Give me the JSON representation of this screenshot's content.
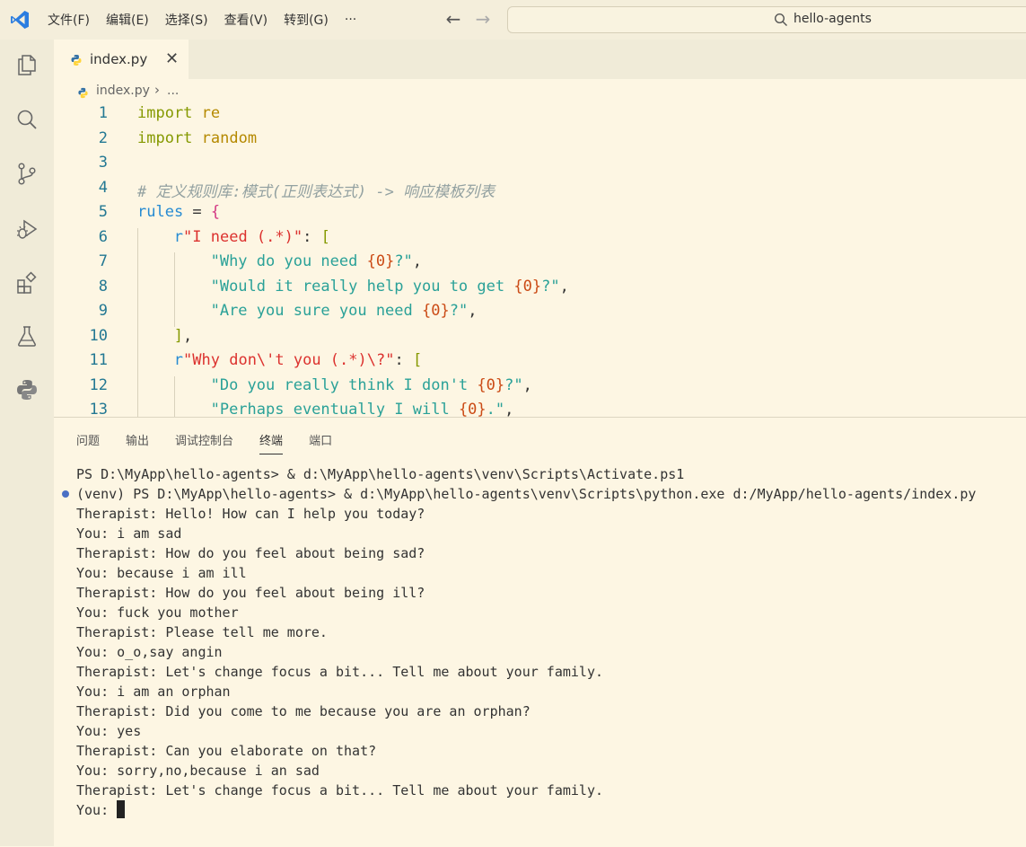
{
  "menubar": {
    "items": [
      "文件(F)",
      "编辑(E)",
      "选择(S)",
      "查看(V)",
      "转到(G)",
      "···"
    ]
  },
  "command_center": {
    "text": "hello-agents"
  },
  "tab": {
    "label": "index.py",
    "close": "✕"
  },
  "breadcrumb": {
    "file": "index.py",
    "sep": "›",
    "more": "..."
  },
  "code_lines": [
    {
      "n": "1",
      "indent": 0,
      "tokens": [
        {
          "c": "kw",
          "t": "import"
        },
        {
          "c": "op",
          "t": " "
        },
        {
          "c": "mod",
          "t": "re"
        }
      ]
    },
    {
      "n": "2",
      "indent": 0,
      "tokens": [
        {
          "c": "kw",
          "t": "import"
        },
        {
          "c": "op",
          "t": " "
        },
        {
          "c": "mod",
          "t": "random"
        }
      ]
    },
    {
      "n": "3",
      "indent": 0,
      "tokens": []
    },
    {
      "n": "4",
      "indent": 0,
      "tokens": [
        {
          "c": "cmt",
          "t": "# 定义规则库:模式(正则表达式) -> 响应模板列表"
        }
      ]
    },
    {
      "n": "5",
      "indent": 0,
      "tokens": [
        {
          "c": "id",
          "t": "rules"
        },
        {
          "c": "op",
          "t": " = "
        },
        {
          "c": "br",
          "t": "{"
        }
      ]
    },
    {
      "n": "6",
      "indent": 1,
      "tokens": [
        {
          "c": "id",
          "t": "r"
        },
        {
          "c": "rx",
          "t": "\"I need (.*)\""
        },
        {
          "c": "op",
          "t": ": "
        },
        {
          "c": "br2",
          "t": "["
        }
      ]
    },
    {
      "n": "7",
      "indent": 2,
      "tokens": [
        {
          "c": "str",
          "t": "\"Why do you need "
        },
        {
          "c": "fmt",
          "t": "{0}"
        },
        {
          "c": "str",
          "t": "?\""
        },
        {
          "c": "op",
          "t": ","
        }
      ]
    },
    {
      "n": "8",
      "indent": 2,
      "tokens": [
        {
          "c": "str",
          "t": "\"Would it really help you to get "
        },
        {
          "c": "fmt",
          "t": "{0}"
        },
        {
          "c": "str",
          "t": "?\""
        },
        {
          "c": "op",
          "t": ","
        }
      ]
    },
    {
      "n": "9",
      "indent": 2,
      "tokens": [
        {
          "c": "str",
          "t": "\"Are you sure you need "
        },
        {
          "c": "fmt",
          "t": "{0}"
        },
        {
          "c": "str",
          "t": "?\""
        },
        {
          "c": "op",
          "t": ","
        }
      ]
    },
    {
      "n": "10",
      "indent": 1,
      "tokens": [
        {
          "c": "br2",
          "t": "]"
        },
        {
          "c": "op",
          "t": ","
        }
      ]
    },
    {
      "n": "11",
      "indent": 1,
      "tokens": [
        {
          "c": "id",
          "t": "r"
        },
        {
          "c": "rx",
          "t": "\"Why don\\'t you (.*)\\?\""
        },
        {
          "c": "op",
          "t": ": "
        },
        {
          "c": "br2",
          "t": "["
        }
      ]
    },
    {
      "n": "12",
      "indent": 2,
      "tokens": [
        {
          "c": "str",
          "t": "\"Do you really think I don't "
        },
        {
          "c": "fmt",
          "t": "{0}"
        },
        {
          "c": "str",
          "t": "?\""
        },
        {
          "c": "op",
          "t": ","
        }
      ]
    },
    {
      "n": "13",
      "indent": 2,
      "tokens": [
        {
          "c": "str",
          "t": "\"Perhaps eventually I will "
        },
        {
          "c": "fmt",
          "t": "{0}"
        },
        {
          "c": "str",
          "t": ".\""
        },
        {
          "c": "op",
          "t": ","
        }
      ]
    }
  ],
  "panel": {
    "tabs": [
      "问题",
      "输出",
      "调试控制台",
      "终端",
      "端口"
    ],
    "active_tab": "终端"
  },
  "terminal_lines": [
    "PS D:\\MyApp\\hello-agents> & d:\\MyApp\\hello-agents\\venv\\Scripts\\Activate.ps1",
    "(venv) PS D:\\MyApp\\hello-agents> & d:\\MyApp\\hello-agents\\venv\\Scripts\\python.exe d:/MyApp/hello-agents/index.py",
    "Therapist: Hello! How can I help you today?",
    "You: i am sad",
    "Therapist: How do you feel about being sad?",
    "You: because i am ill",
    "Therapist: How do you feel about being ill?",
    "You: fuck you mother",
    "Therapist: Please tell me more.",
    "You: o_o,say angin",
    "Therapist: Let's change focus a bit... Tell me about your family.",
    "You: i am an orphan",
    "Therapist: Did you come to me because you are an orphan?",
    "You: yes",
    "Therapist: Can you elaborate on that?",
    "You: sorry,no,because i an sad",
    "Therapist: Let's change focus a bit... Tell me about your family."
  ],
  "terminal_prompt": "You: ",
  "icons": {
    "logo": "vscode-logo-icon",
    "activity": [
      "explorer-icon",
      "search-icon",
      "source-control-icon",
      "run-debug-icon",
      "extensions-icon",
      "testing-icon",
      "python-icon"
    ]
  },
  "colors": {
    "background": "#fdf6e3",
    "keyword": "#859900",
    "string": "#2aa198",
    "regex_string": "#dc322f",
    "format_placeholder": "#cb4b16",
    "comment": "#93a1a1",
    "line_number": "#237893"
  }
}
